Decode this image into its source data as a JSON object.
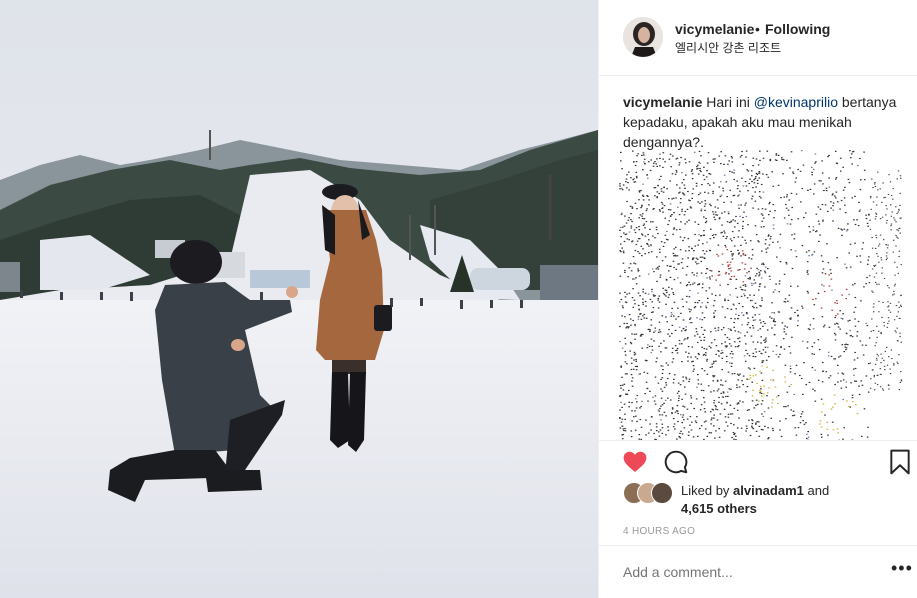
{
  "post": {
    "username": "vicymelanie",
    "separator": "•",
    "follow_label": "Following",
    "location": "엘리시안 강촌 리조트",
    "caption_user": "vicymelanie",
    "caption_before": "Hari ini",
    "caption_mention": "@kevinaprilio",
    "caption_after": "bertanya kepadaku, apakah aku mau menikah dengannya?."
  },
  "likes": {
    "prefix": "Liked by",
    "first_user": "alvinadam1",
    "conjunction": "and",
    "others": "4,615 others"
  },
  "timestamp": "4 HOURS AGO",
  "comment_box": {
    "placeholder": "Add a comment..."
  },
  "icons": {
    "like": "heart-icon",
    "comment": "comment-bubble-icon",
    "save": "bookmark-icon",
    "options": "more-options-icon"
  },
  "colors": {
    "like_red": "#ed4956",
    "text": "#262626",
    "muted": "#999999",
    "mention": "#003569",
    "divider": "#efefef"
  }
}
